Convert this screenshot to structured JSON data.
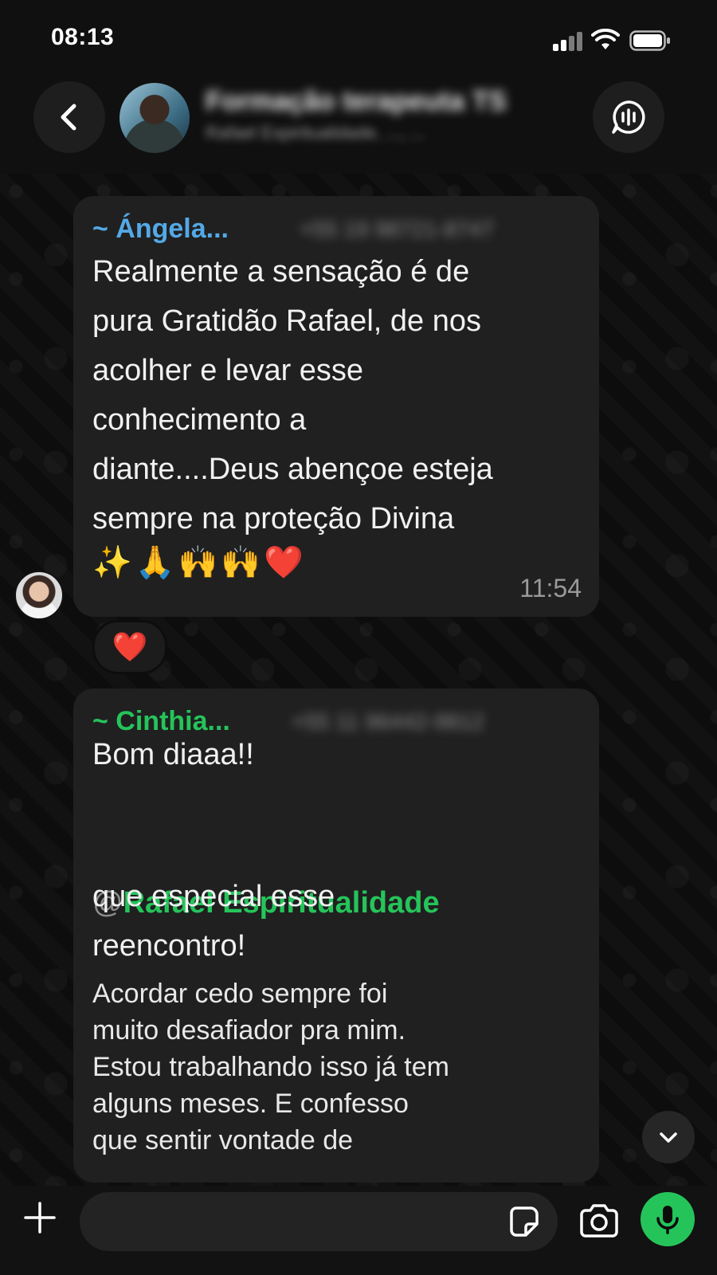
{
  "status_bar": {
    "time": "08:13"
  },
  "header": {
    "group_name": "Formação terapeuta TS",
    "subtitle": "Rafael Espiritualidade, ..., ...",
    "icons": [
      "back-chevron-icon",
      "group-avatar",
      "voice-chat-icon"
    ]
  },
  "messages": [
    {
      "sender": "~ Ángela...",
      "sender_color": "#53a9e6",
      "phone": "+55 19 98721-8747",
      "lines": "Realmente a sensação é de\npura Gratidão Rafael, de nos\nacolher e levar esse\nconhecimento a\ndiante....Deus abençoe esteja\nsempre na proteção Divina",
      "emoji": "✨🙏🙌🙌❤️",
      "time": "11:54",
      "reaction": "❤️"
    },
    {
      "sender": "~ Cinthia...",
      "sender_color": "#25c45a",
      "phone": "+55 11 96442-9812",
      "greeting": "Bom diaaa!!",
      "mention_at": "@",
      "mention_name": "Rafael Espiritualidade",
      "after_mention": "que especial esse\nreencontro!",
      "body": "Acordar cedo sempre foi\nmuito desafiador pra mim.\nEstou trabalhando isso já tem\nalguns meses. E confesso\nque sentir vontade de"
    }
  ],
  "composer": {
    "placeholder": "",
    "accent_color": "#25c45a"
  }
}
